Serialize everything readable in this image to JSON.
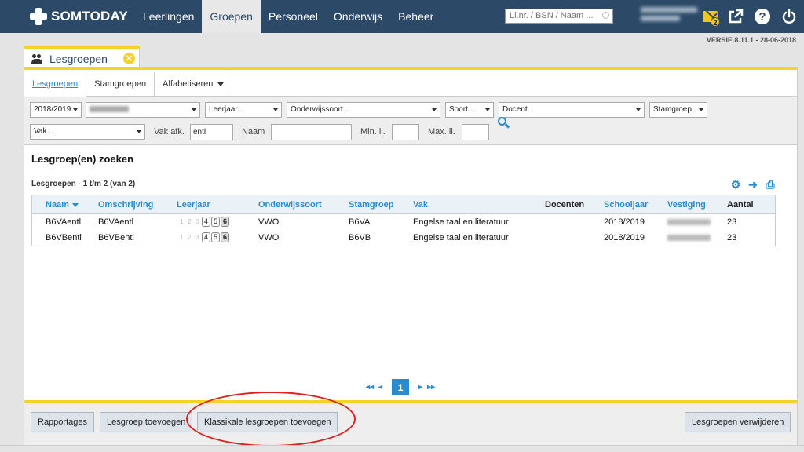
{
  "app": {
    "brand": "SOMTODAY",
    "version": "VERSIE 8.11.1 - 28-06-2018"
  },
  "nav": {
    "items": [
      "Leerlingen",
      "Groepen",
      "Personeel",
      "Onderwijs",
      "Beheer"
    ],
    "active": "Groepen"
  },
  "search": {
    "placeholder": "Ll.nr. / BSN / Naam ..."
  },
  "messages": {
    "count": "2"
  },
  "tab": {
    "title": "Lesgroepen"
  },
  "subtabs": [
    "Lesgroepen",
    "Stamgroepen",
    "Alfabetiseren"
  ],
  "filters": {
    "schoolyear": "2018/2019",
    "leerjaar": "Leerjaar...",
    "onderwijssoort": "Onderwijssoort...",
    "soort": "Soort...",
    "docent": "Docent...",
    "stamgroep": "Stamgroep...",
    "vak": "Vak...",
    "vak_afk_label": "Vak afk.",
    "vak_afk_value": "entl",
    "naam_label": "Naam",
    "min_label": "Min. ll.",
    "max_label": "Max. ll."
  },
  "section_title": "Lesgroep(en) zoeken",
  "result_count": "Lesgroepen - 1 t/m 2 (van 2)",
  "table": {
    "columns": [
      "Naam",
      "Omschrijving",
      "Leerjaar",
      "Onderwijssoort",
      "Stamgroep",
      "Vak",
      "Docenten",
      "Schooljaar",
      "Vestiging",
      "Aantal"
    ],
    "leerjaren": [
      "1",
      "2",
      "3",
      "4",
      "5",
      "6"
    ],
    "rows": [
      {
        "naam": "B6VAentl",
        "omschrijving": "B6VAentl",
        "leerjaar": "6",
        "onderwijssoort": "VWO",
        "stamgroep": "B6VA",
        "vak": "Engelse taal en literatuur",
        "docenten": "",
        "schooljaar": "2018/2019",
        "aantal": "23"
      },
      {
        "naam": "B6VBentl",
        "omschrijving": "B6VBentl",
        "leerjaar": "6",
        "onderwijssoort": "VWO",
        "stamgroep": "B6VB",
        "vak": "Engelse taal en literatuur",
        "docenten": "",
        "schooljaar": "2018/2019",
        "aantal": "23"
      }
    ]
  },
  "pager": {
    "first": "◂◂",
    "prev": "◂",
    "current": "1",
    "next": "▸",
    "last": "▸▸"
  },
  "footer": {
    "rapportages": "Rapportages",
    "toevoegen": "Lesgroep toevoegen",
    "klassikale": "Klassikale lesgroepen toevoegen",
    "verwijderen": "Lesgroepen verwijderen"
  },
  "colors": {
    "topbar": "#2c4a68",
    "accent": "#f5d22a",
    "link": "#2a8bd0",
    "annotation": "#e02020"
  }
}
